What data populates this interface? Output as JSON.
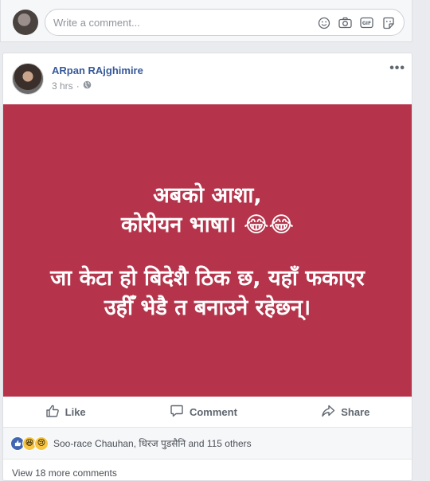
{
  "composer": {
    "placeholder": "Write a comment...",
    "icons": [
      "emoji-icon",
      "camera-icon",
      "gif-icon",
      "sticker-icon"
    ]
  },
  "post": {
    "author": "ARpan RAjghimire",
    "time": "3 hrs",
    "separator": "·",
    "audience_icon": "globe-icon",
    "more": "•••",
    "banner_color": "#b5344b",
    "lines": [
      "अबको आशा,",
      "कोरीयन भाषा। 😂😂",
      "",
      "जा केटा हो बिदेशै ठिक छ, यहाँ फकाएर",
      "उहीँ भेडै त बनाउने रहेछन्।"
    ]
  },
  "actions": {
    "like": "Like",
    "comment": "Comment",
    "share": "Share"
  },
  "reactions": {
    "summary": "Soo-race Chauhan, धिरज पुडसैनि and 115 others",
    "types": [
      "like",
      "haha",
      "sad"
    ]
  },
  "comments": {
    "view_more": "View 18 more comments"
  }
}
